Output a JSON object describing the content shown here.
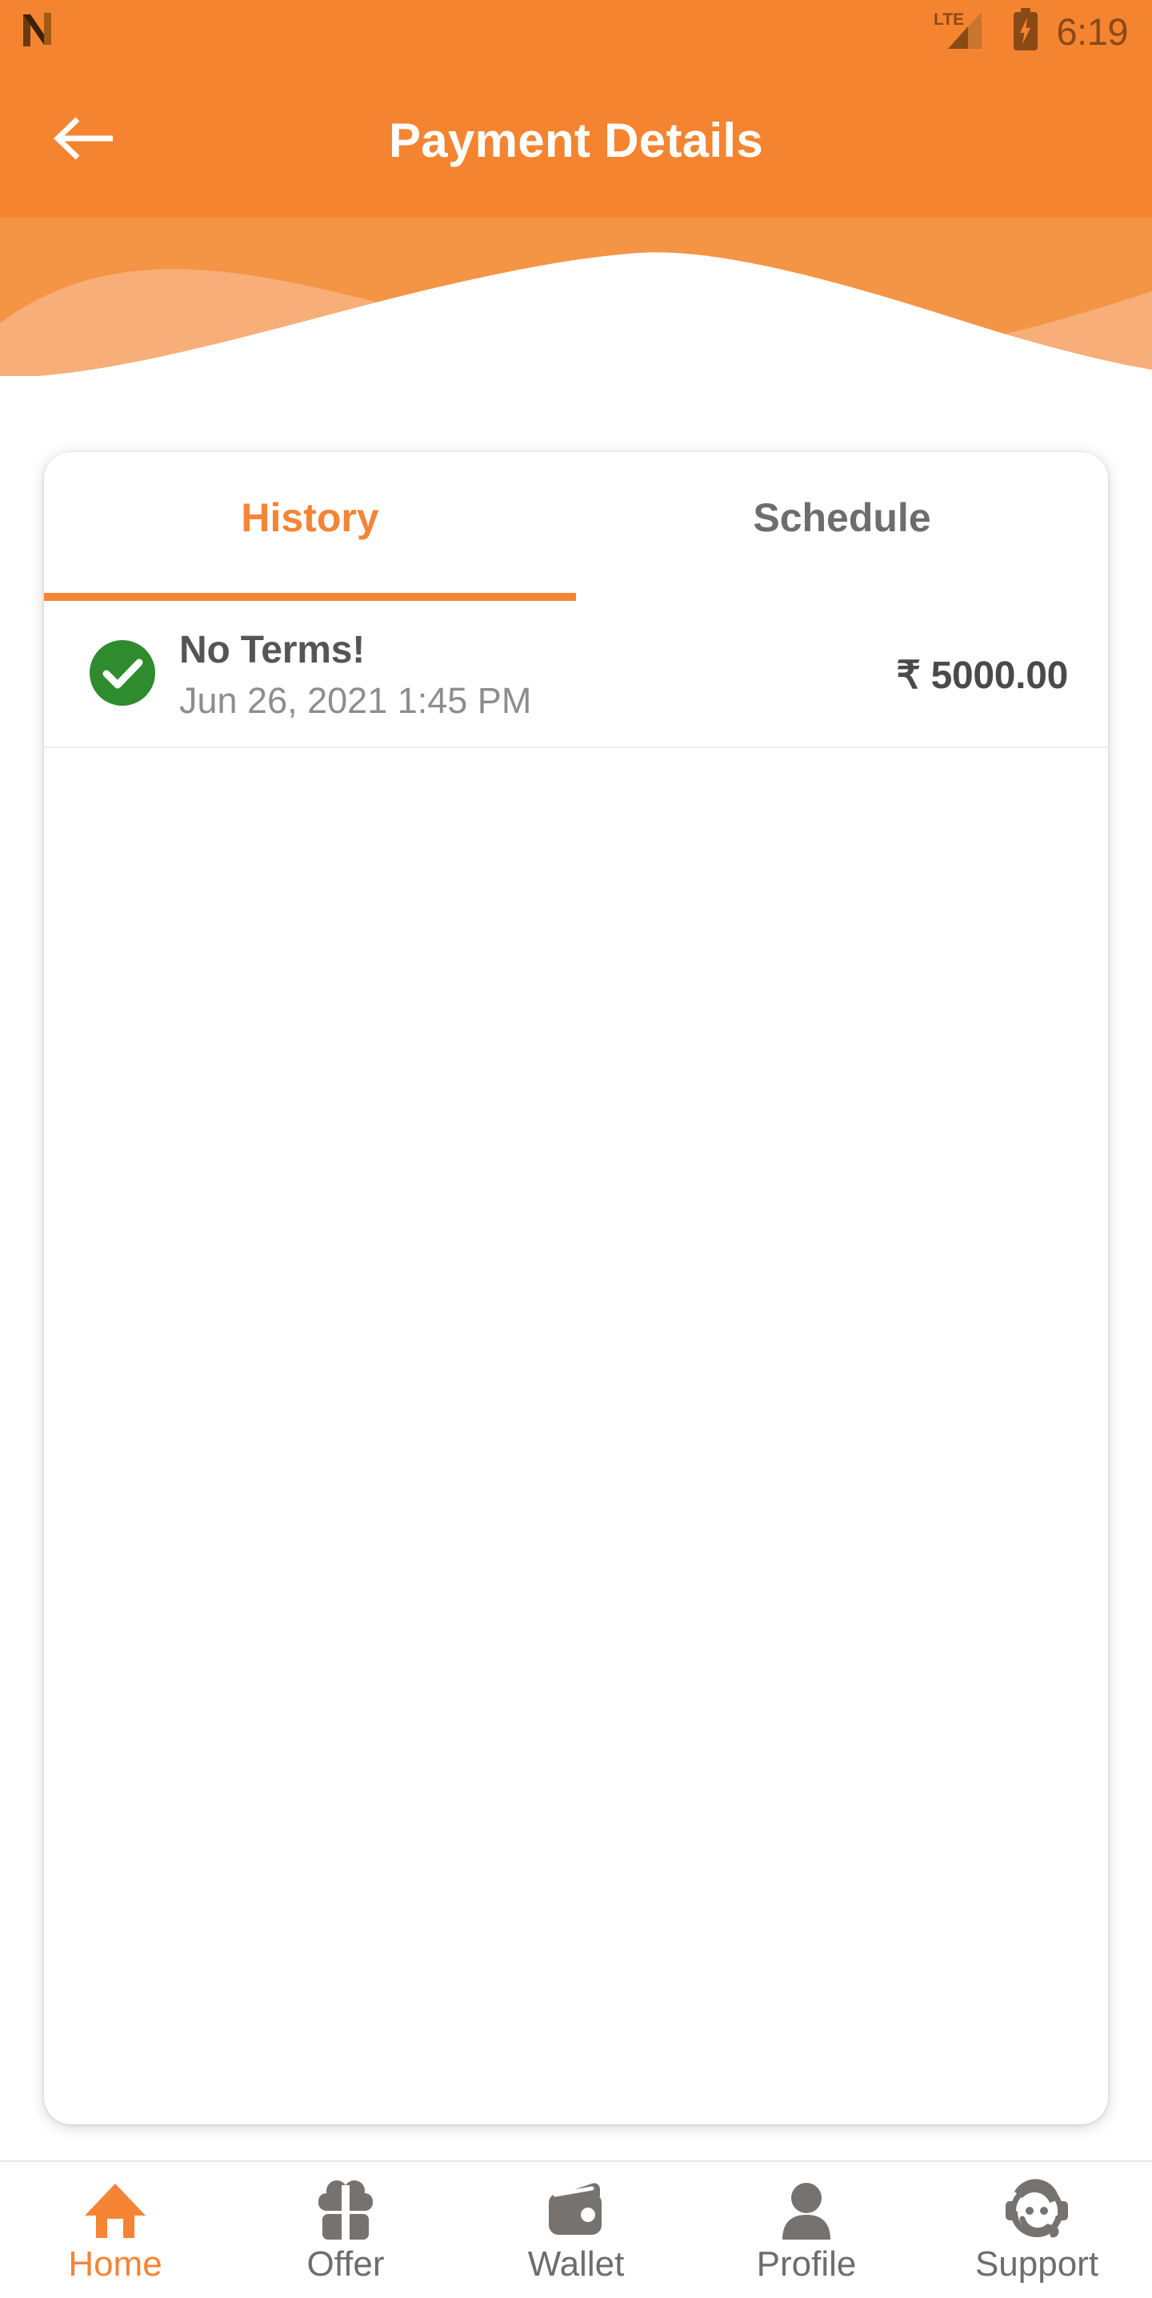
{
  "status_bar": {
    "notification_icon": "app-logo-n-icon",
    "network_type": "LTE",
    "signal_icon": "signal-bars-icon",
    "battery_icon": "battery-charging-icon",
    "time": "6:19"
  },
  "app_bar": {
    "back_icon": "back-arrow-icon",
    "title": "Payment Details"
  },
  "theme": {
    "primary_orange": "#f58430",
    "wave_light": "#f7ae78",
    "wave_mid": "#f49545",
    "success_green": "#2e8b2e",
    "text_gray": "#6d6d6d"
  },
  "card": {
    "tabs": [
      {
        "label": "History",
        "active": true
      },
      {
        "label": "Schedule",
        "active": false
      }
    ],
    "transactions": [
      {
        "status_icon": "check-circle-icon",
        "title": "No Terms!",
        "date": "Jun 26, 2021 1:45 PM",
        "amount": "₹ 5000.00"
      }
    ]
  },
  "bottom_nav": [
    {
      "label": "Home",
      "icon": "home-icon",
      "active": true
    },
    {
      "label": "Offer",
      "icon": "gift-icon",
      "active": false
    },
    {
      "label": "Wallet",
      "icon": "wallet-icon",
      "active": false
    },
    {
      "label": "Profile",
      "icon": "person-icon",
      "active": false
    },
    {
      "label": "Support",
      "icon": "headset-agent-icon",
      "active": false
    }
  ]
}
